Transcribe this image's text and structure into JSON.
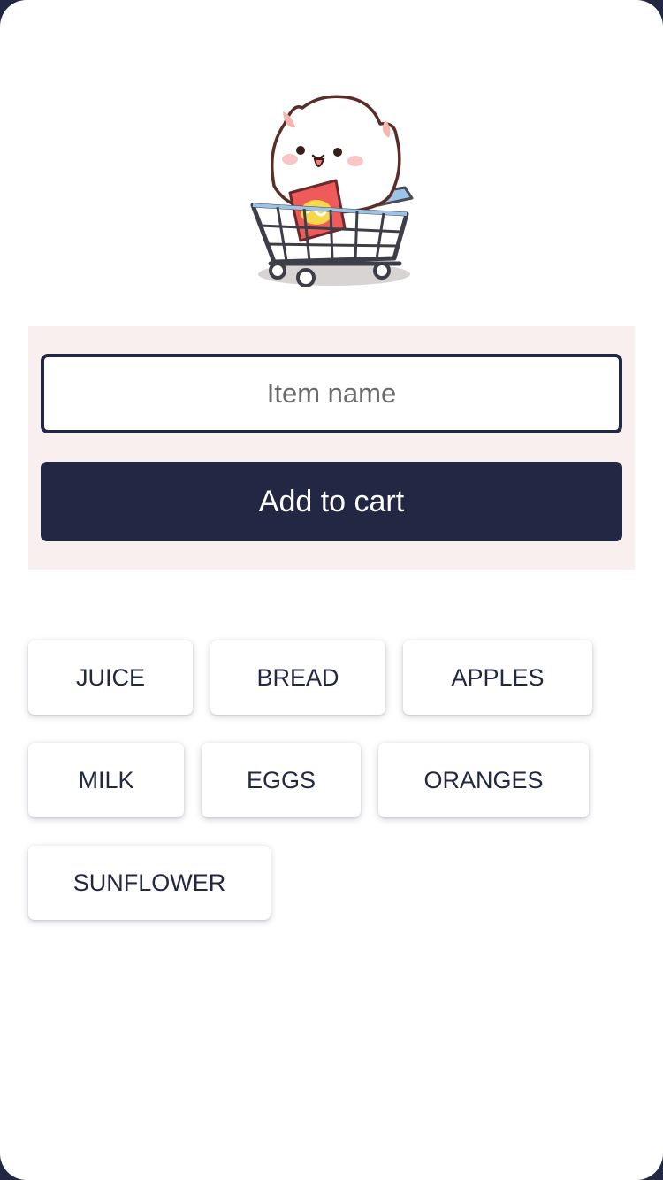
{
  "form": {
    "input_placeholder": "Item name",
    "input_value": "",
    "add_button_label": "Add to cart"
  },
  "items": [
    {
      "label": "JUICE"
    },
    {
      "label": "BREAD"
    },
    {
      "label": "APPLES"
    },
    {
      "label": "MILK"
    },
    {
      "label": "EGGS"
    },
    {
      "label": "ORANGES"
    },
    {
      "label": "SUNFLOWER"
    }
  ],
  "colors": {
    "accent": "#222744",
    "panel_background": "#f9efee",
    "chip_background": "#ffffff"
  },
  "icons": {
    "mascot": "cat-in-shopping-cart-icon"
  }
}
